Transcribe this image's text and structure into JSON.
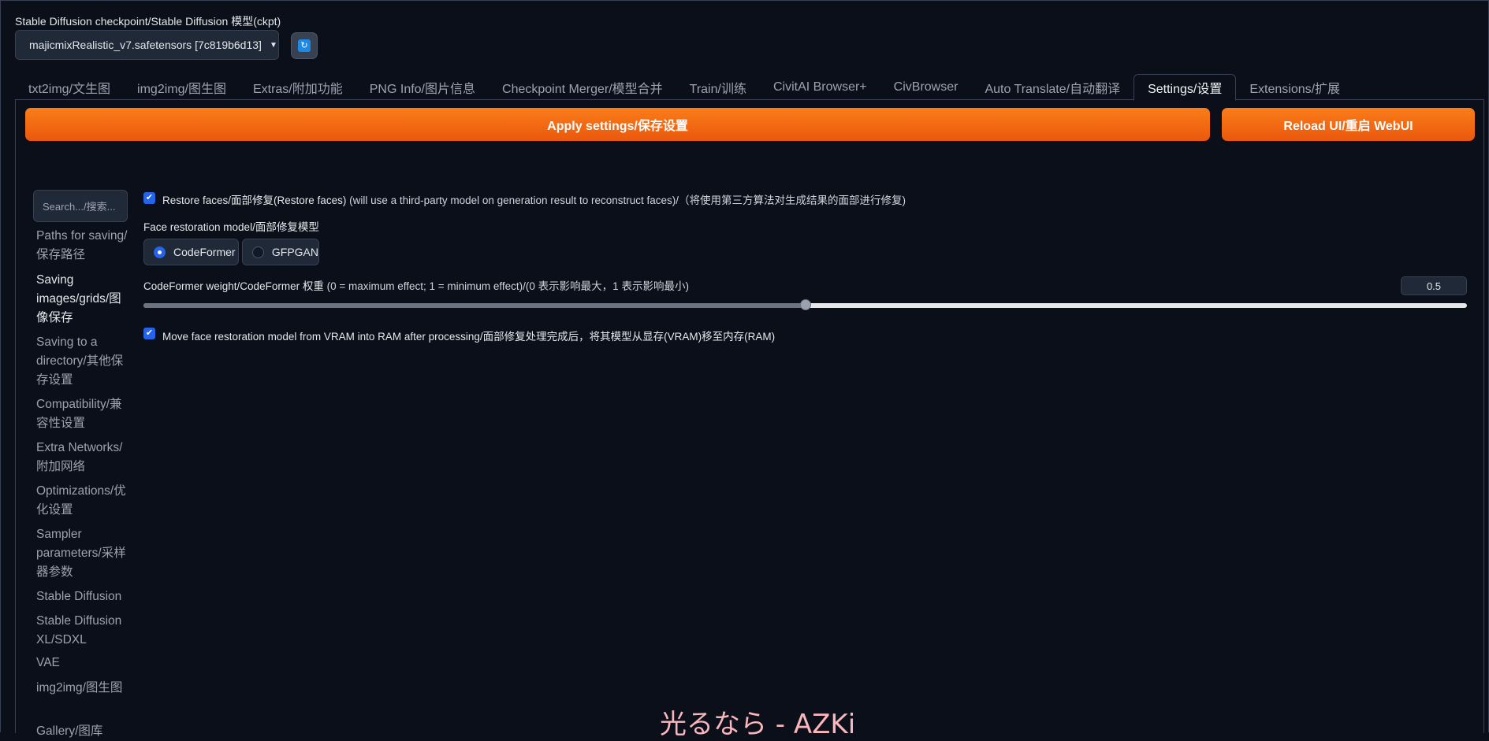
{
  "checkpoint": {
    "label": "Stable Diffusion checkpoint/Stable Diffusion 模型(ckpt)",
    "value": "majicmixRealistic_v7.safetensors [7c819b6d13]",
    "refresh_icon": "refresh-icon"
  },
  "tabs": [
    {
      "label": "txt2img/文生图",
      "active": false
    },
    {
      "label": "img2img/图生图",
      "active": false
    },
    {
      "label": "Extras/附加功能",
      "active": false
    },
    {
      "label": "PNG Info/图片信息",
      "active": false
    },
    {
      "label": "Checkpoint Merger/模型合并",
      "active": false
    },
    {
      "label": "Train/训练",
      "active": false
    },
    {
      "label": "CivitAI Browser+",
      "active": false
    },
    {
      "label": "CivBrowser",
      "active": false
    },
    {
      "label": "Auto Translate/自动翻译",
      "active": false
    },
    {
      "label": "Settings/设置",
      "active": true
    },
    {
      "label": "Extensions/扩展",
      "active": false
    }
  ],
  "actions": {
    "apply": "Apply settings/保存设置",
    "reload": "Reload UI/重启 WebUI"
  },
  "sidebar": {
    "search_placeholder": "Search.../搜索...",
    "items": [
      {
        "label": "Paths for saving/保存路径",
        "active": false
      },
      {
        "label": "Saving images/grids/图像保存",
        "active": true
      },
      {
        "label": "Saving to a directory/其他保存设置",
        "active": false
      },
      {
        "label": "Compatibility/兼容性设置",
        "active": false
      },
      {
        "label": "Extra Networks/附加网络",
        "active": false
      },
      {
        "label": "Optimizations/优化设置",
        "active": false
      },
      {
        "label": "Sampler parameters/采样器参数",
        "active": false
      },
      {
        "label": "Stable Diffusion",
        "active": false
      },
      {
        "label": "Stable Diffusion XL/SDXL",
        "active": false
      },
      {
        "label": "VAE",
        "active": false
      },
      {
        "label": "img2img/图生图",
        "active": false
      },
      {
        "label": "Gallery/图库",
        "active": false
      }
    ]
  },
  "settings": {
    "restore_faces": {
      "checked": true,
      "label": "Restore faces/面部修复(Restore faces)",
      "hint": "(will use a third-party model on generation result to reconstruct faces)/（将使用第三方算法对生成结果的面部进行修复)"
    },
    "face_model": {
      "label": "Face restoration model/面部修复模型",
      "options": [
        "CodeFormer",
        "GFPGAN"
      ],
      "selected": "CodeFormer"
    },
    "codeformer_weight": {
      "label": "CodeFormer weight/CodeFormer 权重",
      "hint": "(0 = maximum effect; 1 = minimum effect)/(0 表示影响最大，1 表示影响最小)",
      "value": "0.5",
      "fraction": 0.5
    },
    "move_to_ram": {
      "checked": true,
      "label": "Move face restoration model from VRAM into RAM after processing/面部修复处理完成后，将其模型从显存(VRAM)移至内存(RAM)"
    }
  },
  "overlay": {
    "text": "光るなら - AZKi",
    "color": "#f9b6bc"
  },
  "colors": {
    "background": "#0b0f19",
    "accent_orange": "#f97316",
    "checkbox_blue": "#2563eb"
  }
}
